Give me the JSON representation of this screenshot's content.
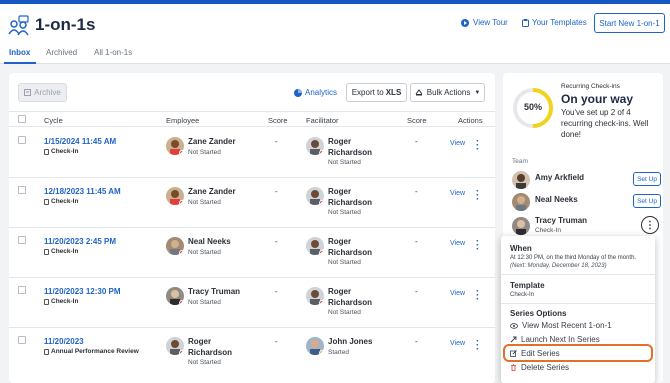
{
  "header": {
    "title": "1-on-1s",
    "view_tour": "View Tour",
    "your_templates": "Your Templates",
    "start_new": "Start New 1-on-1"
  },
  "tabs": [
    {
      "label": "Inbox",
      "active": true
    },
    {
      "label": "Archived",
      "active": false
    },
    {
      "label": "All 1-on-1s",
      "active": false
    }
  ],
  "toolbar": {
    "archive": "Archive",
    "analytics": "Analytics",
    "export_prefix": "Export to",
    "export_format": "XLS",
    "bulk_actions": "Bulk Actions"
  },
  "table": {
    "columns": [
      "Cycle",
      "Employee",
      "Score",
      "Facilitator",
      "Score",
      "Actions"
    ],
    "rows": [
      {
        "date": "1/15/2024 11:45 AM",
        "type": "Check-In",
        "employee": "Zane Zander",
        "emp_status": "Not Started",
        "emp_score": "-",
        "facilitator": "Roger Richardson",
        "fac_status": "Not Started",
        "fac_score": "-",
        "action": "View"
      },
      {
        "date": "12/18/2023 11:45 AM",
        "type": "Check-In",
        "employee": "Zane Zander",
        "emp_status": "Not Started",
        "emp_score": "-",
        "facilitator": "Roger Richardson",
        "fac_status": "Not Started",
        "fac_score": "-",
        "action": "View"
      },
      {
        "date": "11/20/2023 2:45 PM",
        "type": "Check-In",
        "employee": "Neal Neeks",
        "emp_status": "Not Started",
        "emp_score": "-",
        "facilitator": "Roger Richardson",
        "fac_status": "Not Started",
        "fac_score": "-",
        "action": "View"
      },
      {
        "date": "11/20/2023 12:30 PM",
        "type": "Check-In",
        "employee": "Tracy Truman",
        "emp_status": "Not Started",
        "emp_score": "-",
        "facilitator": "Roger Richardson",
        "fac_status": "Not Started",
        "fac_score": "-",
        "action": "View"
      },
      {
        "date": "11/20/2023",
        "type": "Annual Performance Review",
        "employee": "Roger Richardson",
        "emp_status": "Not Started",
        "emp_score": "-",
        "facilitator": "John Jones",
        "fac_status": "Started",
        "fac_score": "-",
        "action": "View"
      }
    ]
  },
  "sidebar": {
    "recurring_label": "Recurring Check-ins",
    "progress_percent": 50,
    "progress_text": "50%",
    "headline": "On your way",
    "description": "You've set up 2 of 4 recurring check-ins. Well done!",
    "team_label": "Team",
    "members": [
      {
        "name": "Amy Arkfield",
        "action": "Set Up"
      },
      {
        "name": "Neal Neeks",
        "action": "Set Up"
      },
      {
        "name": "Tracy Truman",
        "sub": "Check-In"
      }
    ]
  },
  "menu": {
    "when_label": "When",
    "when_text": "At 12:30 PM, on the third Monday of the month.",
    "when_next": "(Next: Monday, December 18, 2023)",
    "template_label": "Template",
    "template_value": "Check-In",
    "series_label": "Series Options",
    "items": [
      "View Most Recent 1-on-1",
      "Launch Next In Series",
      "Edit Series",
      "Delete Series"
    ]
  },
  "colors": {
    "accent": "#1f63c9",
    "topbar": "#1557c0",
    "progress": "#f2d21b",
    "highlight": "#e0702b",
    "status_dot": "#e23b3b"
  }
}
